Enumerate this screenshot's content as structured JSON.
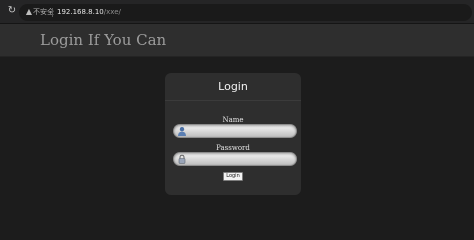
{
  "browser": {
    "security_label": "不安全",
    "url_host": "192.168.8.10",
    "url_path": "/xxe/"
  },
  "site": {
    "title": "Login If You Can"
  },
  "login": {
    "heading": "Login",
    "name_label": "Name",
    "name_value": "",
    "password_label": "Password",
    "password_value": "",
    "button_label": "Login"
  },
  "icons": {
    "reload": "reload-icon",
    "security": "warning-icon",
    "name_field": "user-icon",
    "password_field": "lock-icon"
  }
}
